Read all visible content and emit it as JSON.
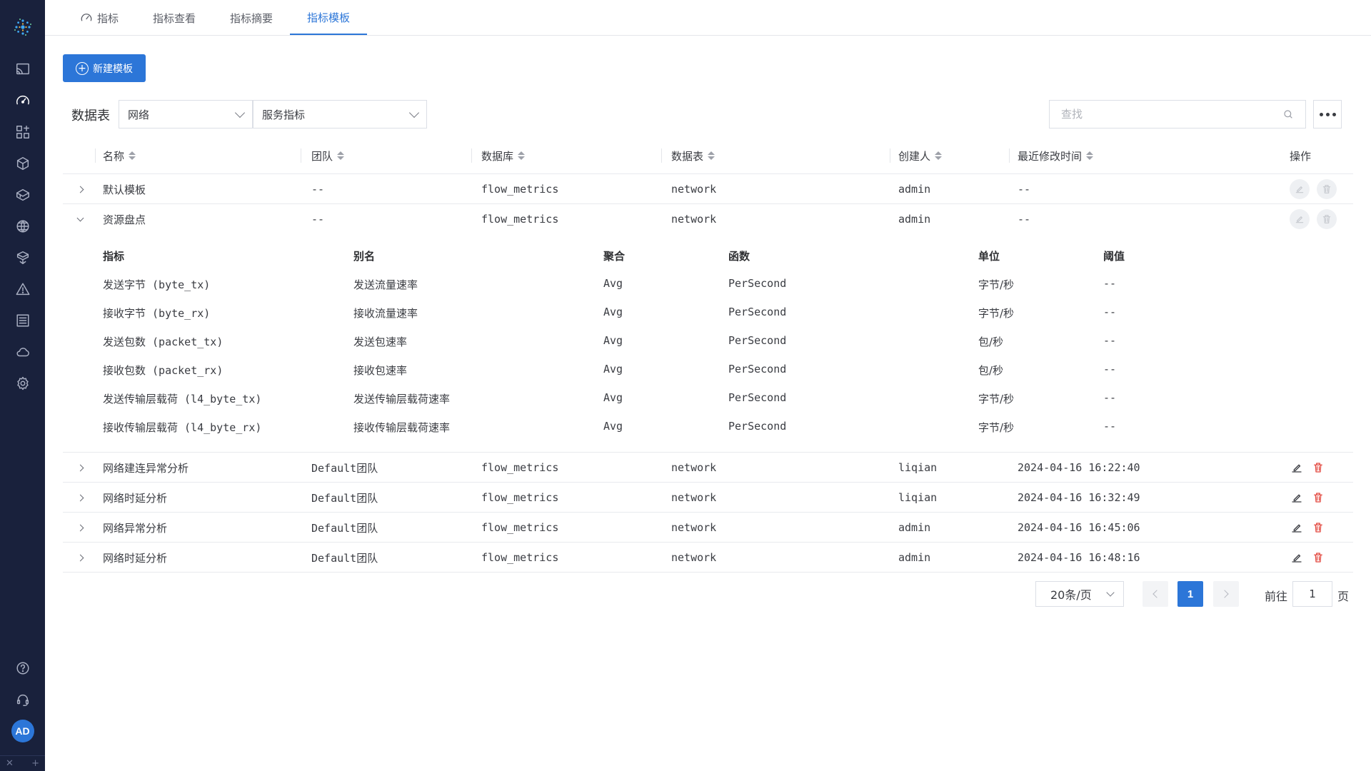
{
  "sidebar": {
    "items": [
      {
        "name": "screen-icon"
      },
      {
        "name": "gauge-icon",
        "active": true
      },
      {
        "name": "topology-icon"
      },
      {
        "name": "package-icon"
      },
      {
        "name": "boxes-icon"
      },
      {
        "name": "globe-icon"
      },
      {
        "name": "cube-icon"
      },
      {
        "name": "alert-icon"
      },
      {
        "name": "list-icon"
      },
      {
        "name": "cloud-icon"
      },
      {
        "name": "gear-icon"
      }
    ],
    "bottom": [
      {
        "name": "help-icon"
      },
      {
        "name": "headset-icon"
      }
    ],
    "avatar": "AD"
  },
  "tabs": [
    {
      "label": "指标",
      "icon": "gauge-icon"
    },
    {
      "label": "指标查看"
    },
    {
      "label": "指标摘要"
    },
    {
      "label": "指标模板",
      "active": true
    }
  ],
  "toolbar": {
    "new_label": "新建模板"
  },
  "filter": {
    "label": "数据表",
    "db_select": "网络",
    "table_select": "服务指标",
    "search_placeholder": "查找"
  },
  "table": {
    "headers": {
      "name": "名称",
      "team": "团队",
      "database": "数据库",
      "datatable": "数据表",
      "creator": "创建人",
      "modified": "最近修改时间",
      "ops": "操作"
    },
    "rows": [
      {
        "name": "默认模板",
        "team": "--",
        "database": "flow_metrics",
        "datatable": "network",
        "creator": "admin",
        "modified": "--"
      },
      {
        "name": "资源盘点",
        "team": "--",
        "database": "flow_metrics",
        "datatable": "network",
        "creator": "admin",
        "modified": "--"
      },
      {
        "name": "网络建连异常分析",
        "team": "Default团队",
        "database": "flow_metrics",
        "datatable": "network",
        "creator": "liqian",
        "modified": "2024-04-16 16:22:40"
      },
      {
        "name": "网络时延分析",
        "team": "Default团队",
        "database": "flow_metrics",
        "datatable": "network",
        "creator": "liqian",
        "modified": "2024-04-16 16:32:49"
      },
      {
        "name": "网络异常分析",
        "team": "Default团队",
        "database": "flow_metrics",
        "datatable": "network",
        "creator": "admin",
        "modified": "2024-04-16 16:45:06"
      },
      {
        "name": "网络时延分析",
        "team": "Default团队",
        "database": "flow_metrics",
        "datatable": "network",
        "creator": "admin",
        "modified": "2024-04-16 16:48:16"
      }
    ]
  },
  "detail": {
    "headers": {
      "metric": "指标",
      "alias": "别名",
      "agg": "聚合",
      "func": "函数",
      "unit": "单位",
      "threshold": "阈值"
    },
    "rows": [
      {
        "metric": "发送字节 (byte_tx)",
        "alias": "发送流量速率",
        "agg": "Avg",
        "func": "PerSecond",
        "unit": "字节/秒",
        "threshold": "--"
      },
      {
        "metric": "接收字节 (byte_rx)",
        "alias": "接收流量速率",
        "agg": "Avg",
        "func": "PerSecond",
        "unit": "字节/秒",
        "threshold": "--"
      },
      {
        "metric": "发送包数 (packet_tx)",
        "alias": "发送包速率",
        "agg": "Avg",
        "func": "PerSecond",
        "unit": "包/秒",
        "threshold": "--"
      },
      {
        "metric": "接收包数 (packet_rx)",
        "alias": "接收包速率",
        "agg": "Avg",
        "func": "PerSecond",
        "unit": "包/秒",
        "threshold": "--"
      },
      {
        "metric": "发送传输层载荷 (l4_byte_tx)",
        "alias": "发送传输层载荷速率",
        "agg": "Avg",
        "func": "PerSecond",
        "unit": "字节/秒",
        "threshold": "--"
      },
      {
        "metric": "接收传输层载荷 (l4_byte_rx)",
        "alias": "接收传输层载荷速率",
        "agg": "Avg",
        "func": "PerSecond",
        "unit": "字节/秒",
        "threshold": "--"
      }
    ]
  },
  "pager": {
    "size": "20条/页",
    "current": "1",
    "goto_label": "前往",
    "goto_value": "1",
    "goto_suffix": "页"
  },
  "colors": {
    "accent": "#2c76d8",
    "sidebar": "#19213c",
    "delete": "#e2453c"
  }
}
